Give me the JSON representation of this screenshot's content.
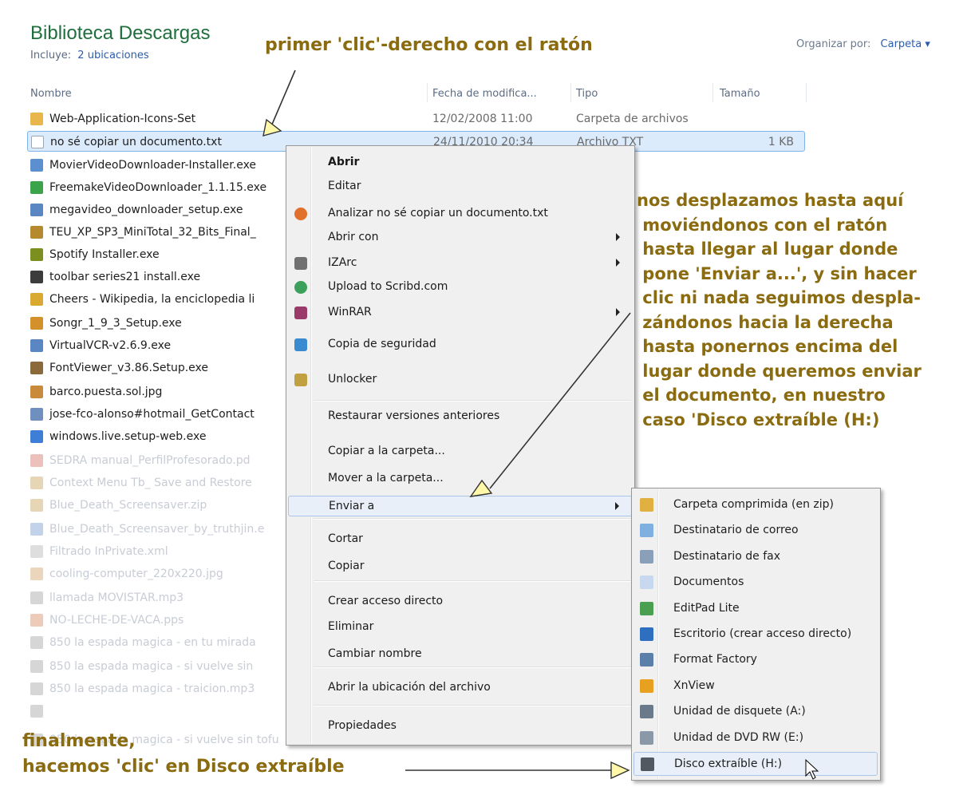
{
  "header": {
    "title": "Biblioteca Descargas",
    "includes_prefix": "Incluye:",
    "includes_link": "2 ubicaciones",
    "organize_label": "Organizar por:",
    "organize_value": "Carpeta ▾"
  },
  "columns": {
    "name": "Nombre",
    "date": "Fecha de modifica...",
    "type": "Tipo",
    "size": "Tamaño"
  },
  "files": [
    {
      "name": "Web-Application-Icons-Set",
      "date": "12/02/2008 11:00",
      "type": "Carpeta de archivos",
      "size": "",
      "icon": "folder-icon",
      "color": "#e8b64a"
    },
    {
      "name": "no sé copiar un documento.txt",
      "date": "24/11/2010 20:34",
      "type": "Archivo TXT",
      "size": "1 KB",
      "icon": "text-file-icon",
      "color": "#ffffff"
    },
    {
      "name": "MovierVideoDownloader-Installer.exe",
      "date": "",
      "type": "",
      "size": "",
      "icon": "installer-icon",
      "color": "#5b8fd0"
    },
    {
      "name": "FreemakeVideoDownloader_1.1.15.exe",
      "date": "",
      "type": "",
      "size": "",
      "icon": "freemake-icon",
      "color": "#3ba34a"
    },
    {
      "name": "megavideo_downloader_setup.exe",
      "date": "",
      "type": "",
      "size": "",
      "icon": "setup-icon",
      "color": "#5a86c4"
    },
    {
      "name": "TEU_XP_SP3_MiniTotal_32_Bits_Final_",
      "date": "",
      "type": "",
      "size": "",
      "icon": "archive-icon",
      "color": "#b7892e"
    },
    {
      "name": "Spotify Installer.exe",
      "date": "",
      "type": "",
      "size": "",
      "icon": "spotify-icon",
      "color": "#7a8f1e"
    },
    {
      "name": "toolbar series21 install.exe",
      "date": "",
      "type": "",
      "size": "",
      "icon": "toolbar-icon",
      "color": "#3c3c3c"
    },
    {
      "name": "Cheers - Wikipedia, la enciclopedia li",
      "date": "",
      "type": "",
      "size": "",
      "icon": "web-page-icon",
      "color": "#d9a932"
    },
    {
      "name": "Songr_1_9_3_Setup.exe",
      "date": "",
      "type": "",
      "size": "",
      "icon": "music-icon",
      "color": "#d4902a"
    },
    {
      "name": "VirtualVCR-v2.6.9.exe",
      "date": "",
      "type": "",
      "size": "",
      "icon": "setup-icon",
      "color": "#5a86c4"
    },
    {
      "name": "FontViewer_v3.86.Setup.exe",
      "date": "",
      "type": "",
      "size": "",
      "icon": "font-icon",
      "color": "#8a6a3a"
    },
    {
      "name": "barco.puesta.sol.jpg",
      "date": "",
      "type": "",
      "size": "",
      "icon": "image-icon",
      "color": "#c98a3c"
    },
    {
      "name": "jose-fco-alonso#hotmail_GetContact",
      "date": "",
      "type": "",
      "size": "",
      "icon": "contact-file-icon",
      "color": "#6f8fbf"
    },
    {
      "name": "windows.live.setup-web.exe",
      "date": "",
      "type": "",
      "size": "",
      "icon": "windows-live-icon",
      "color": "#3f7ed6"
    },
    {
      "name": "SEDRA manual_PerfilProfesorado.pd",
      "date": "",
      "type": "",
      "size": "",
      "icon": "pdf-icon",
      "color": "#c94c3b"
    },
    {
      "name": "Context Menu Tb_ Save and Restore",
      "date": "",
      "type": "",
      "size": "",
      "icon": "archive-icon",
      "color": "#b7892e"
    },
    {
      "name": "Blue_Death_Screensaver.zip",
      "date": "",
      "type": "",
      "size": "",
      "icon": "zip-icon",
      "color": "#b7892e"
    },
    {
      "name": "Blue_Death_Screensaver_by_truthjin.e",
      "date": "",
      "type": "",
      "size": "",
      "icon": "screensaver-icon",
      "color": "#4f7fc0"
    },
    {
      "name": "Filtrado InPrivate.xml",
      "date": "",
      "type": "",
      "size": "",
      "icon": "xml-icon",
      "color": "#a0a0a0"
    },
    {
      "name": "cooling-computer_220x220.jpg",
      "date": "",
      "type": "",
      "size": "",
      "icon": "image-icon",
      "color": "#c98a3c"
    },
    {
      "name": "llamada MOVISTAR.mp3",
      "date": "",
      "type": "",
      "size": "",
      "icon": "audio-icon",
      "color": "#8a8a8a"
    },
    {
      "name": "NO-LECHE-DE-VACA.pps",
      "date": "",
      "type": "",
      "size": "",
      "icon": "presentation-icon",
      "color": "#c96a3a"
    },
    {
      "name": "850 la espada magica - en tu mirada",
      "date": "",
      "type": "",
      "size": "",
      "icon": "audio-icon",
      "color": "#8a8a8a"
    },
    {
      "name": "850 la espada magica - si vuelve sin",
      "date": "",
      "type": "",
      "size": "",
      "icon": "audio-icon",
      "color": "#8a8a8a"
    },
    {
      "name": "850 la espada magica - traicion.mp3",
      "date": "",
      "type": "",
      "size": "",
      "icon": "audio-icon",
      "color": "#8a8a8a"
    },
    {
      "name": "",
      "date": "",
      "type": "",
      "size": "",
      "icon": "audio-icon",
      "color": "#8a8a8a"
    },
    {
      "name": "850 la espada magica - si vuelve sin tofu",
      "date": "",
      "type": "",
      "size": "",
      "icon": "audio-icon",
      "color": "#8a8a8a"
    }
  ],
  "context_menu": [
    {
      "label": "Abrir",
      "bold": true,
      "icon": "",
      "arrow": false
    },
    {
      "label": "Editar",
      "bold": false,
      "icon": "",
      "arrow": false
    },
    {
      "label": "Analizar no sé copiar un documento.txt",
      "bold": false,
      "icon": "antivirus-icon",
      "arrow": false
    },
    {
      "label": "Abrir con",
      "bold": false,
      "icon": "",
      "arrow": true
    },
    {
      "label": "IZArc",
      "bold": false,
      "icon": "izarc-icon",
      "arrow": true
    },
    {
      "label": "Upload to Scribd.com",
      "bold": false,
      "icon": "upload-icon",
      "arrow": false
    },
    {
      "label": "WinRAR",
      "bold": false,
      "icon": "winrar-icon",
      "arrow": true
    },
    {
      "label": "Copia de seguridad",
      "bold": false,
      "icon": "backup-icon",
      "arrow": false
    },
    {
      "label": "Unlocker",
      "bold": false,
      "icon": "unlocker-icon",
      "arrow": false
    },
    {
      "label": "Restaurar versiones anteriores",
      "bold": false,
      "icon": "",
      "arrow": false
    },
    {
      "label": "Copiar a la carpeta...",
      "bold": false,
      "icon": "",
      "arrow": false
    },
    {
      "label": "Mover a la carpeta...",
      "bold": false,
      "icon": "",
      "arrow": false
    },
    {
      "label": "Enviar a",
      "bold": false,
      "icon": "",
      "arrow": true
    },
    {
      "label": "Cortar",
      "bold": false,
      "icon": "",
      "arrow": false
    },
    {
      "label": "Copiar",
      "bold": false,
      "icon": "",
      "arrow": false
    },
    {
      "label": "Crear acceso directo",
      "bold": false,
      "icon": "",
      "arrow": false
    },
    {
      "label": "Eliminar",
      "bold": false,
      "icon": "",
      "arrow": false
    },
    {
      "label": "Cambiar nombre",
      "bold": false,
      "icon": "",
      "arrow": false
    },
    {
      "label": "Abrir la ubicación del archivo",
      "bold": false,
      "icon": "",
      "arrow": false
    },
    {
      "label": "Propiedades",
      "bold": false,
      "icon": "",
      "arrow": false
    }
  ],
  "submenu": [
    {
      "label": "Carpeta comprimida (en zip)",
      "icon": "zip-folder-icon",
      "color": "#e0b040"
    },
    {
      "label": "Destinatario de correo",
      "icon": "mail-icon",
      "color": "#7fb0e0"
    },
    {
      "label": "Destinatario de fax",
      "icon": "fax-icon",
      "color": "#8aa0b8"
    },
    {
      "label": "Documentos",
      "icon": "documents-icon",
      "color": "#c8d8ee"
    },
    {
      "label": "EditPad Lite",
      "icon": "editpad-icon",
      "color": "#4aa050"
    },
    {
      "label": "Escritorio (crear acceso directo)",
      "icon": "desktop-icon",
      "color": "#2f6fc0"
    },
    {
      "label": "Format Factory",
      "icon": "format-factory-icon",
      "color": "#5a7fa8"
    },
    {
      "label": "XnView",
      "icon": "xnview-icon",
      "color": "#e8a020"
    },
    {
      "label": "Unidad de disquete (A:)",
      "icon": "floppy-icon",
      "color": "#6a7a8a"
    },
    {
      "label": "Unidad de DVD RW (E:)",
      "icon": "dvd-drive-icon",
      "color": "#8a98a8"
    },
    {
      "label": "Disco extraíble (H:)",
      "icon": "removable-disk-icon",
      "color": "#505860"
    }
  ],
  "annotations": {
    "first_click": "primer 'clic'-derecho con el ratón",
    "move_text": "nos desplazamos hasta aquí\n moviéndonos con el ratón\n hasta llegar al lugar donde\n pone 'Enviar a...', y sin hacer\n clic ni nada seguimos despla-\n zándonos hacia la derecha\n hasta ponernos encima del\n lugar donde queremos enviar\n el documento, en nuestro\n caso 'Disco extraíble (H:)",
    "final_text": "finalmente,\nhacemos 'clic' en Disco extraíble"
  },
  "colors": {
    "annotation": "#8a6b10",
    "title_green": "#1e6f3c",
    "link_blue": "#2a5db0",
    "selection": "#dcebfc",
    "menu_bg": "#f0f0f0"
  }
}
